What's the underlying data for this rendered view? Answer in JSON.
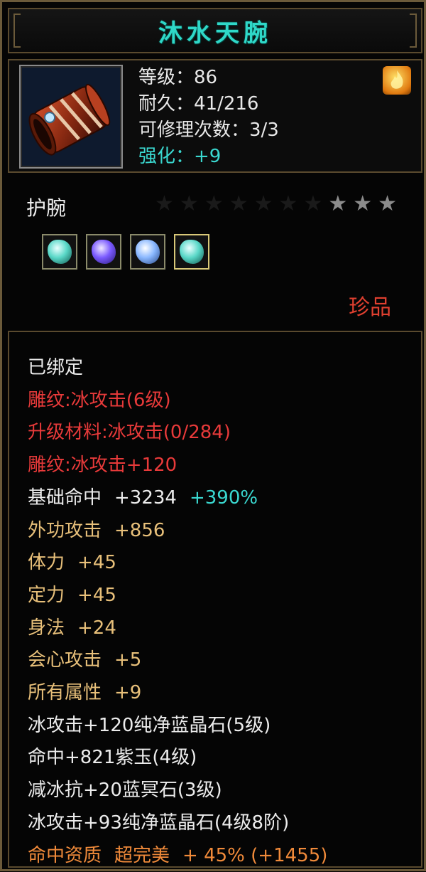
{
  "item": {
    "name": "沐水天腕",
    "level_line": "等级：86",
    "durability_line": "耐久：41/216",
    "repair_line": "可修理次数：3/3",
    "enhance_line": "强化：+9",
    "type": "护腕",
    "rarity": "珍品",
    "stars_total": 10,
    "stars_lit": 3,
    "icon": "red-bracer-icon",
    "badge_icon": "flame-badge-icon"
  },
  "gems": [
    {
      "icon": "teal-crystal-gem-icon",
      "color": "teal",
      "selected": false
    },
    {
      "icon": "purple-jade-gem-icon",
      "color": "purple",
      "selected": false
    },
    {
      "icon": "blue-crystal-gem-icon",
      "color": "lightblue",
      "selected": false
    },
    {
      "icon": "teal-crystal-gem-icon",
      "color": "teal",
      "selected": true
    }
  ],
  "attributes": {
    "bound": "已绑定",
    "engrave1": "雕纹:冰攻击(6级)",
    "upgrade": "升级材料:冰攻击(0/284)",
    "engrave2": "雕纹:冰攻击+120",
    "hit": {
      "label": "基础命中",
      "value": "+3234",
      "bonus": "+390%"
    },
    "ext_attack": {
      "label": "外功攻击",
      "value": "+856"
    },
    "stamina": {
      "label": "体力",
      "value": "+45"
    },
    "focus": {
      "label": "定力",
      "value": "+45"
    },
    "agility": {
      "label": "身法",
      "value": "+24"
    },
    "crit": {
      "label": "会心攻击",
      "value": "+5"
    },
    "all": {
      "label": "所有属性",
      "value": "+9"
    },
    "gem1": "冰攻击+120纯净蓝晶石(5级)",
    "gem2": "命中+821紫玉(4级)",
    "gem3": "减冰抗+20蓝冥石(3级)",
    "gem4": "冰攻击+93纯净蓝晶石(4级8阶)",
    "quality": {
      "label": "命中资质",
      "grade": "超完美",
      "value": "+ 45% (+1455)"
    }
  },
  "colors": {
    "title": "#2fd8c8",
    "red": "#e83a3a",
    "tan": "#e8c07a",
    "orange": "#f08a3a",
    "cyan": "#3ad8d0",
    "border": "#5a4a2e"
  }
}
